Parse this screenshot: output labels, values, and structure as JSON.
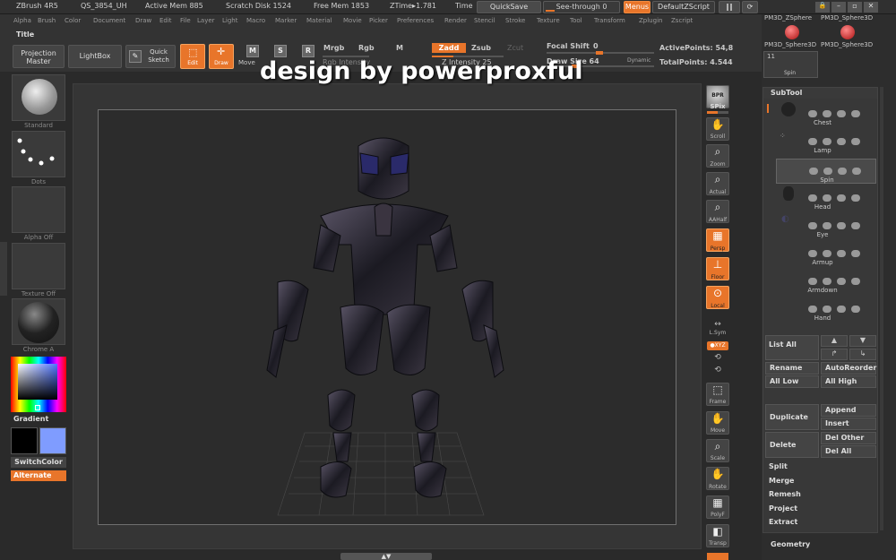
{
  "app": {
    "title": "ZBrush 4R5",
    "build": "QS_3854_UH",
    "active_mem": "Active Mem 885",
    "scratch": "Scratch Disk 1524",
    "free_mem": "Free Mem 1853",
    "ztime": "ZTime▸1.781",
    "time": "Time"
  },
  "topbar": {
    "quicksave": "QuickSave",
    "seethrough": "See-through  0",
    "menus": "Menus",
    "script": "DefaultZScript"
  },
  "menus": [
    "Alpha",
    "Brush",
    "Color",
    "Document",
    "Draw",
    "Edit",
    "File",
    "Layer",
    "Light",
    "Macro",
    "Marker",
    "Material",
    "Movie",
    "Picker",
    "Preferences",
    "Render",
    "Stencil",
    "Stroke",
    "Texture",
    "Tool",
    "Transform",
    "Zplugin",
    "Zscript"
  ],
  "toolbar": {
    "title": "Title",
    "projection": "Projection Master",
    "lightbox": "LightBox",
    "quick_sketch": "Quick Sketch",
    "edit": "Edit",
    "draw": "Draw",
    "move": "Move",
    "mrgb": "Mrgb",
    "rgb": "Rgb",
    "m": "M",
    "zadd": "Zadd",
    "zsub": "Zsub",
    "zcut": "Zcut",
    "focal_shift": "Focal Shift",
    "focal_val": "0",
    "rgb_intensity": "Rgb Intensity",
    "z_intensity": "Z Intensity 25",
    "draw_size": "Draw Size 64",
    "dynamic": "Dynamic",
    "active_points": "ActivePoints: 54,8",
    "total_points": "TotalPoints: 4.544"
  },
  "watermark": "design by powerproxful",
  "left": {
    "standard": "Standard",
    "dots": "Dots",
    "alpha_off": "Alpha Off",
    "texture_off": "Texture Off",
    "chrome": "Chrome A",
    "gradient": "Gradient",
    "switch_color": "SwitchColor",
    "alternate": "Alternate"
  },
  "shelf": {
    "bpr": "BPR",
    "spix": "SPix",
    "scroll": "Scroll",
    "zoom": "Zoom",
    "actual": "Actual",
    "aahalf": "AAHalf",
    "persp": "Persp",
    "floor": "Floor",
    "local": "Local",
    "lsym": "L.Sym",
    "xyz": "●XYZ",
    "frame": "Frame",
    "move": "Move",
    "scale": "Scale",
    "rotate": "Rotate",
    "polyf": "PolyF",
    "transp": "Transp"
  },
  "right": {
    "sphere1": "PM3D_ZSphere",
    "sphere2": "PM3D_Sphere3D",
    "sphere3": "PM3D_Sphere3D",
    "sphere4": "PM3D_Sphere3D",
    "spin_count": "11",
    "spin": "Spin",
    "subtool": "SubTool",
    "items": [
      {
        "name": "Chest"
      },
      {
        "name": "Lamp"
      },
      {
        "name": "Spin"
      },
      {
        "name": "Head"
      },
      {
        "name": "Eye"
      },
      {
        "name": "Armup"
      },
      {
        "name": "Armdown"
      },
      {
        "name": "Hand"
      }
    ],
    "list_all": "List  All",
    "rename": "Rename",
    "autoreorder": "AutoReorder",
    "all_low": "All Low",
    "all_high": "All High",
    "duplicate": "Duplicate",
    "append": "Append",
    "insert": "Insert",
    "delete": "Delete",
    "del_other": "Del Other",
    "del_all": "Del All",
    "split": "Split",
    "merge": "Merge",
    "remesh": "Remesh",
    "project": "Project",
    "extract": "Extract",
    "geometry": "Geometry"
  },
  "colors": {
    "accent": "#e8752a",
    "secondary": "#7f9cff"
  }
}
